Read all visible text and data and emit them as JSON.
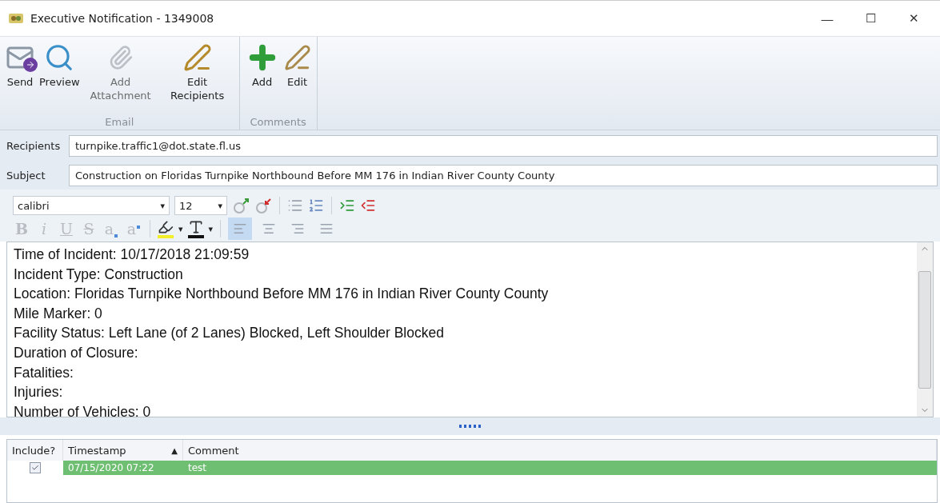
{
  "window": {
    "title": "Executive Notification - 1349008",
    "controls": [
      "—",
      "☐",
      "✕"
    ]
  },
  "ribbon": {
    "groups": [
      {
        "label": "Email",
        "buttons": [
          {
            "kind": "send",
            "label": "Send",
            "disabled": false
          },
          {
            "kind": "preview",
            "label": "Preview",
            "disabled": false
          },
          {
            "kind": "attach",
            "label": "Add Attachment",
            "disabled": true
          },
          {
            "kind": "recipients",
            "label": "Edit Recipients",
            "disabled": false
          }
        ]
      },
      {
        "label": "Comments",
        "buttons": [
          {
            "kind": "add",
            "label": "Add",
            "disabled": false
          },
          {
            "kind": "edit",
            "label": "Edit",
            "disabled": false
          }
        ]
      }
    ]
  },
  "fields": [
    {
      "label": "Recipients",
      "value": "turnpike.traffic1@dot.state.fl.us"
    },
    {
      "label": "Subject",
      "value": "Construction on Floridas Turnpike Northbound Before MM 176 in Indian River County County"
    }
  ],
  "format_bar": {
    "font": "calibri",
    "size": "12",
    "caret": "▾",
    "styles": [
      {
        "kind": "bold",
        "label": "B"
      },
      {
        "kind": "italic",
        "label": "i"
      },
      {
        "kind": "underline",
        "label": "U"
      },
      {
        "kind": "strike",
        "label": "S"
      },
      {
        "kind": "sub",
        "label": "a"
      },
      {
        "kind": "sup",
        "label": "a"
      }
    ],
    "align": [
      {
        "kind": "left",
        "selected": true
      },
      {
        "kind": "center",
        "selected": false
      },
      {
        "kind": "right",
        "selected": false
      },
      {
        "kind": "justify",
        "selected": false
      }
    ]
  },
  "editor": {
    "lines": [
      "Time of Incident: 10/17/2018 21:09:59",
      "Incident Type: Construction",
      "Location: Floridas Turnpike Northbound Before MM 176 in Indian River County County",
      "Mile Marker: 0",
      "Facility Status: Left Lane (of 2 Lanes) Blocked, Left Shoulder Blocked",
      "Duration of Closure:",
      "Fatalities:",
      "Injuries:",
      "Number of Vehicles: 0"
    ]
  },
  "grid": {
    "columns": [
      "Include?",
      "Timestamp",
      "Comment"
    ],
    "sort_indicator": "▲",
    "rows": [
      {
        "include": true,
        "timestamp": "07/15/2020 07:22",
        "comment": "test",
        "selected": true
      }
    ]
  }
}
